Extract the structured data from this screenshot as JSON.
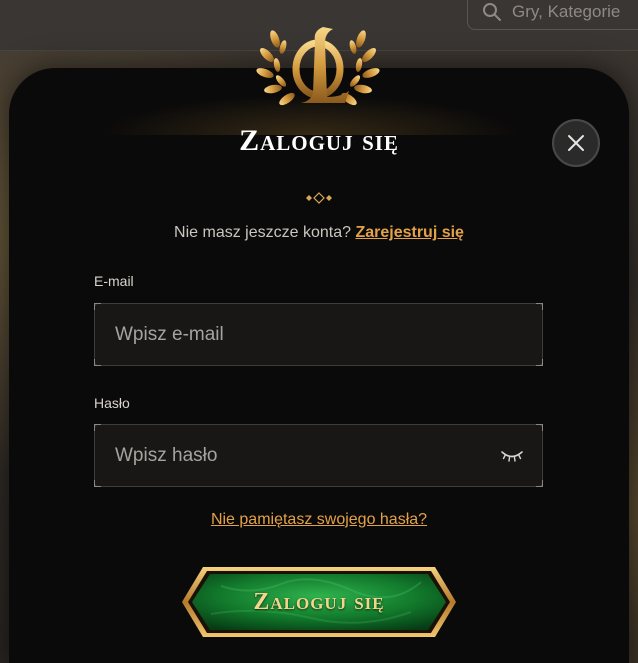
{
  "background": {
    "search_placeholder": "Gry, Kategorie"
  },
  "modal": {
    "title": "Zaloguj się",
    "no_account_text": "Nie masz jeszcze konta?",
    "signup_link": "Zarejestruj się",
    "email": {
      "label": "E-mail",
      "placeholder": "Wpisz e-mail",
      "value": ""
    },
    "password": {
      "label": "Hasło",
      "placeholder": "Wpisz hasło",
      "value": ""
    },
    "forgot_password": "Nie pamiętasz swojego hasła?",
    "login_button": "Zaloguj się",
    "logo_monogram": "OL"
  },
  "colors": {
    "accent_gold": "#e3a247",
    "modal_bg": "#0b0a0a",
    "button_green": "#0f7a2a"
  },
  "icons": {
    "close": "close-icon",
    "search": "search-icon",
    "password_toggle": "closed-eye-icon"
  }
}
